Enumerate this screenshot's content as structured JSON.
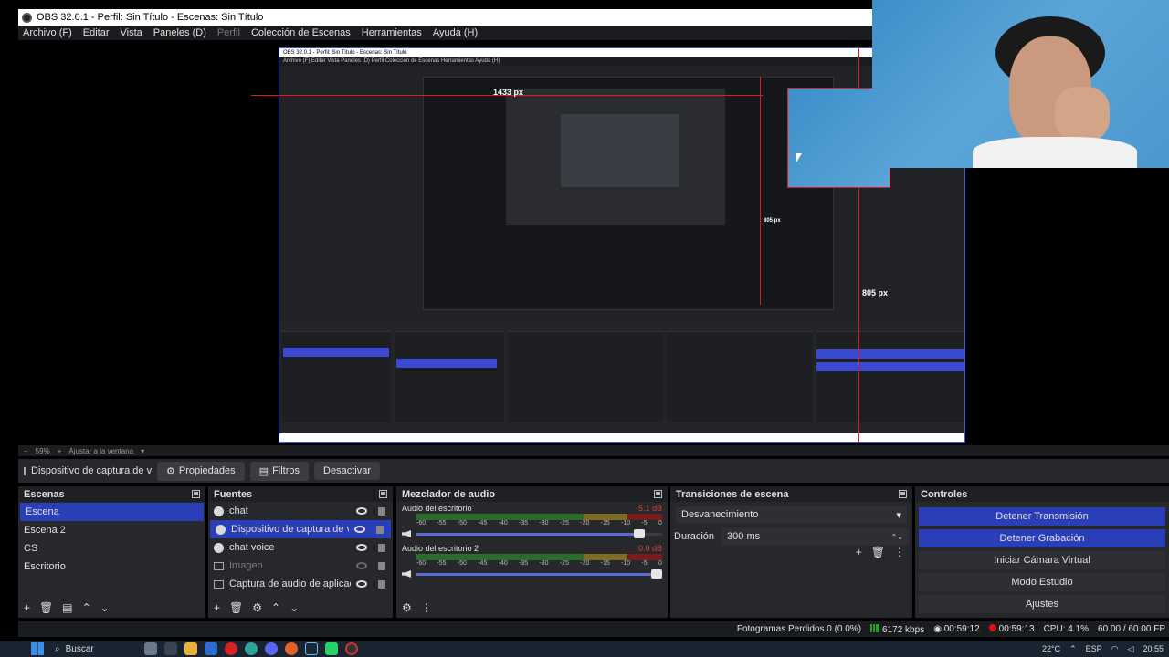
{
  "window": {
    "title": "OBS 32.0.1 - Perfil: Sin Título - Escenas: Sin Título"
  },
  "menu": [
    "Archivo (F)",
    "Editar",
    "Vista",
    "Paneles (D)",
    "Perfil",
    "Colección de Escenas",
    "Herramientas",
    "Ayuda (H)"
  ],
  "preview": {
    "nested_title": "OBS 32.0.1 - Perfil: Sin Título - Escenas: Sin Título",
    "nested_menu": "Archivo (F)   Editar   Vista   Paneles (D)   Perfil   Colección de Escenas   Herramientas   Ayuda (H)",
    "label_top": "1433 px",
    "label_mid": "805 px",
    "label_right": "805 px"
  },
  "zoom": {
    "value": "59%",
    "fit_label": "Ajustar a la ventana"
  },
  "source_toolbar": {
    "current_source": "Dispositivo de captura de v",
    "properties": "Propiedades",
    "filters": "Filtros",
    "deactivate": "Desactivar"
  },
  "scenes": {
    "title": "Escenas",
    "items": [
      "Escena",
      "Escena 2",
      "CS",
      "Escritorio"
    ],
    "selected": 0
  },
  "sources": {
    "title": "Fuentes",
    "items": [
      {
        "label": "chat",
        "icon": "globe-icon"
      },
      {
        "label": "Dispositivo de captura de video",
        "icon": "camera-icon"
      },
      {
        "label": "chat voice",
        "icon": "globe-icon"
      },
      {
        "label": "Imagen",
        "icon": "image-icon"
      },
      {
        "label": "Captura de audio de aplicación (BE",
        "icon": "audio-capture-icon"
      }
    ]
  },
  "mixer": {
    "title": "Mezclador de audio",
    "scale": [
      "-60",
      "-55",
      "-50",
      "-45",
      "-40",
      "-35",
      "-30",
      "-25",
      "-20",
      "-15",
      "-10",
      "-5",
      "0"
    ],
    "tracks": [
      {
        "name": "Audio del escritorio",
        "db": "-5.1 dB",
        "volume": 0.93
      },
      {
        "name": "Audio del escritorio 2",
        "db": "0.0 dB",
        "volume": 1.0
      }
    ]
  },
  "transitions": {
    "title": "Transiciones de escena",
    "selected": "Desvanecimiento",
    "duration_label": "Duración",
    "duration_value": "300 ms"
  },
  "controls": {
    "title": "Controles",
    "buttons": [
      "Detener Transmisión",
      "Detener Grabación",
      "Iniciar Cámara Virtual",
      "Modo Estudio",
      "Ajustes"
    ]
  },
  "status": {
    "dropped": "Fotogramas Perdidos 0 (0.0%)",
    "bitrate": "6172 kbps",
    "stream_time": "00:59:12",
    "rec_time": "00:59:13",
    "cpu": "CPU: 4.1%",
    "fps": "60.00 / 60.00 FP"
  },
  "taskbar": {
    "search": "Buscar",
    "temp": "22°C",
    "lang": "ESP",
    "clock": "20:55"
  }
}
